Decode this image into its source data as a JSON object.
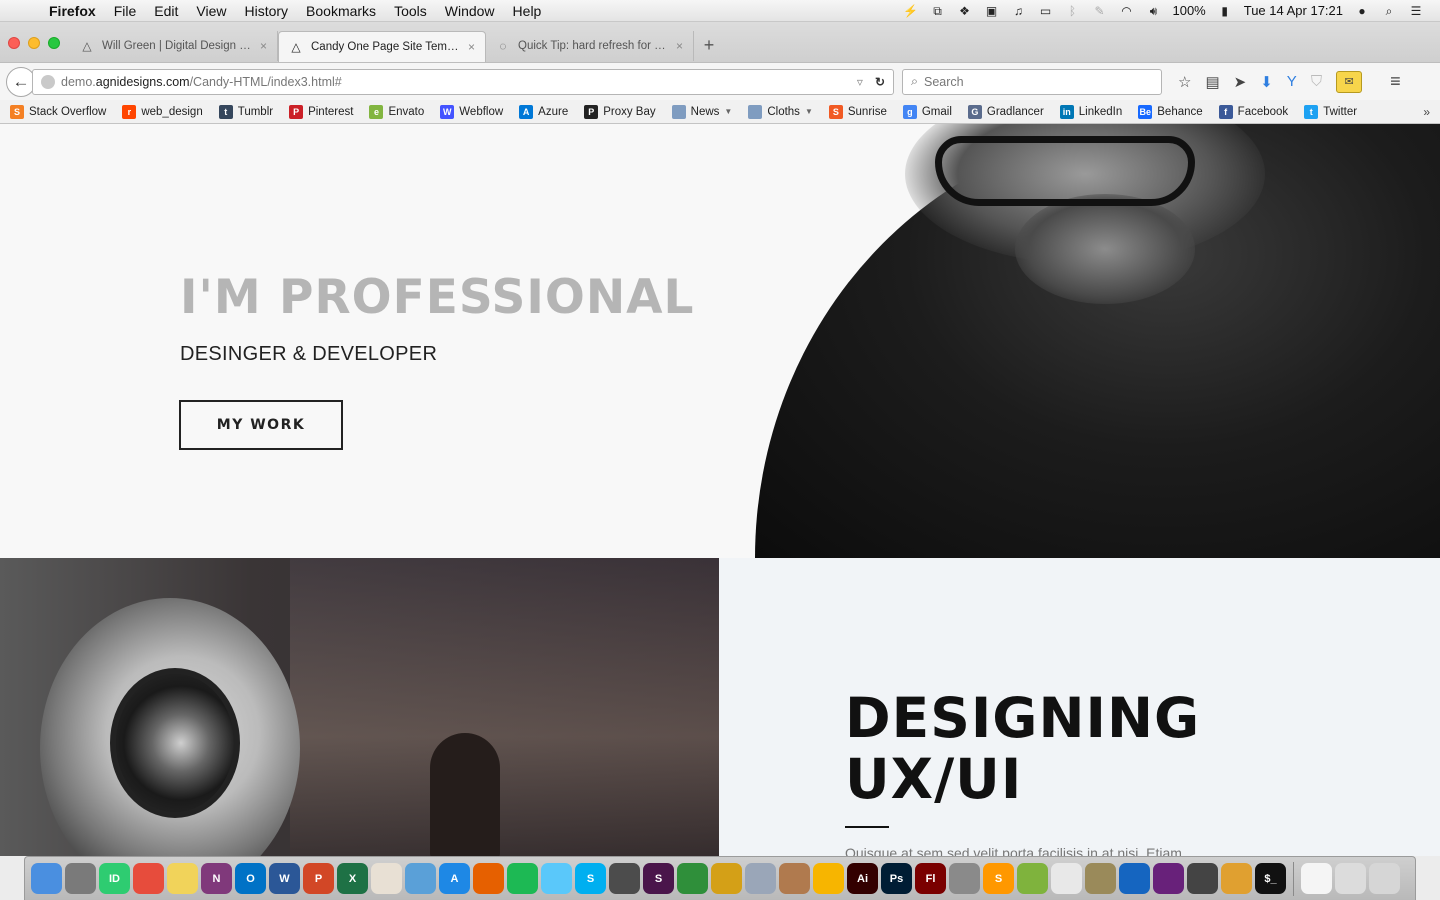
{
  "menubar": {
    "apple": "",
    "app_name": "Firefox",
    "menus": [
      "File",
      "Edit",
      "View",
      "History",
      "Bookmarks",
      "Tools",
      "Window",
      "Help"
    ],
    "battery": "100%",
    "datetime": "Tue 14 Apr  17:21"
  },
  "tabs": [
    {
      "title": "Will Green | Digital Design a...",
      "icon": "triangle-icon",
      "active": false
    },
    {
      "title": "Candy One Page Site Temp...",
      "icon": "triangle-icon",
      "active": true
    },
    {
      "title": "Quick Tip: hard refresh for F...",
      "icon": "loading-icon",
      "active": false
    }
  ],
  "navbar": {
    "url_prefix": "demo.",
    "url_host": "agnidesigns.com",
    "url_path": "/Candy-HTML/index3.html#",
    "search_placeholder": "Search"
  },
  "bookmarks": [
    {
      "label": "Stack Overflow",
      "color": "#f48024",
      "glyph": "S"
    },
    {
      "label": "web_design",
      "color": "#ff4500",
      "glyph": "r"
    },
    {
      "label": "Tumblr",
      "color": "#35465c",
      "glyph": "t"
    },
    {
      "label": "Pinterest",
      "color": "#cb2027",
      "glyph": "P"
    },
    {
      "label": "Envato",
      "color": "#82b540",
      "glyph": "e"
    },
    {
      "label": "Webflow",
      "color": "#4353ff",
      "glyph": "W"
    },
    {
      "label": "Azure",
      "color": "#0078d7",
      "glyph": "A"
    },
    {
      "label": "Proxy Bay",
      "color": "#222222",
      "glyph": "P"
    },
    {
      "label": "News",
      "color": "#7f9cc0",
      "glyph": "",
      "folder": true
    },
    {
      "label": "Cloths",
      "color": "#7f9cc0",
      "glyph": "",
      "folder": true
    },
    {
      "label": "Sunrise",
      "color": "#f15a24",
      "glyph": "S"
    },
    {
      "label": "Gmail",
      "color": "#4285f4",
      "glyph": "g"
    },
    {
      "label": "Gradlancer",
      "color": "#5a6b8c",
      "glyph": "G"
    },
    {
      "label": "LinkedIn",
      "color": "#0077b5",
      "glyph": "in"
    },
    {
      "label": "Behance",
      "color": "#1769ff",
      "glyph": "Be"
    },
    {
      "label": "Facebook",
      "color": "#3b5998",
      "glyph": "f"
    },
    {
      "label": "Twitter",
      "color": "#1da1f2",
      "glyph": "t"
    }
  ],
  "hero": {
    "title": "I'M PROFESSIONAL",
    "subtitle": "DESINGER & DEVELOPER",
    "button": "MY WORK"
  },
  "section2": {
    "title": "DESIGNING\nUX/UI",
    "text": "Quisque at sem sed velit porta facilisis in at nisi. Etiam"
  },
  "dock": [
    {
      "name": "finder-icon",
      "color": "#4a8fe0",
      "glyph": ""
    },
    {
      "name": "system-preferences-icon",
      "color": "#7a7a7a",
      "glyph": ""
    },
    {
      "name": "intellij-icon",
      "color": "#2ecc71",
      "glyph": "ID"
    },
    {
      "name": "opera-icon",
      "color": "#e74c3c",
      "glyph": ""
    },
    {
      "name": "stickies-icon",
      "color": "#f1d35a",
      "glyph": ""
    },
    {
      "name": "onenote-icon",
      "color": "#80397b",
      "glyph": "N"
    },
    {
      "name": "outlook-icon",
      "color": "#0072c6",
      "glyph": "O"
    },
    {
      "name": "word-icon",
      "color": "#2b5797",
      "glyph": "W"
    },
    {
      "name": "powerpoint-icon",
      "color": "#d24726",
      "glyph": "P"
    },
    {
      "name": "excel-icon",
      "color": "#1e7145",
      "glyph": "X"
    },
    {
      "name": "popcorn-icon",
      "color": "#e8e0d4",
      "glyph": ""
    },
    {
      "name": "drop-icon",
      "color": "#5aa0d8",
      "glyph": ""
    },
    {
      "name": "app-store-icon",
      "color": "#1e88e5",
      "glyph": "A"
    },
    {
      "name": "firefox-icon",
      "color": "#e66000",
      "glyph": ""
    },
    {
      "name": "spotify-icon",
      "color": "#1db954",
      "glyph": ""
    },
    {
      "name": "messages-icon",
      "color": "#5ac8fa",
      "glyph": ""
    },
    {
      "name": "skype-icon",
      "color": "#00aff0",
      "glyph": "S"
    },
    {
      "name": "scrivener-icon",
      "color": "#4c4c4c",
      "glyph": ""
    },
    {
      "name": "slack-icon",
      "color": "#4a154b",
      "glyph": "S"
    },
    {
      "name": "codekit-icon",
      "color": "#2f8f3a",
      "glyph": ""
    },
    {
      "name": "chrome-canary-icon",
      "color": "#d4a017",
      "glyph": ""
    },
    {
      "name": "preview-icon",
      "color": "#9aa6b8",
      "glyph": ""
    },
    {
      "name": "photos-icon",
      "color": "#b07a4e",
      "glyph": ""
    },
    {
      "name": "sketch-icon",
      "color": "#f7b500",
      "glyph": ""
    },
    {
      "name": "illustrator-icon",
      "color": "#330000",
      "glyph": "Ai"
    },
    {
      "name": "photoshop-icon",
      "color": "#001d34",
      "glyph": "Ps"
    },
    {
      "name": "flash-icon",
      "color": "#7a0000",
      "glyph": "Fl"
    },
    {
      "name": "scanner-icon",
      "color": "#8a8a8a",
      "glyph": ""
    },
    {
      "name": "sublime-icon",
      "color": "#ff9800",
      "glyph": "S"
    },
    {
      "name": "coda-icon",
      "color": "#7fb33d",
      "glyph": ""
    },
    {
      "name": "prism-icon",
      "color": "#e8e8e8",
      "glyph": ""
    },
    {
      "name": "robot-icon",
      "color": "#9a8a5a",
      "glyph": ""
    },
    {
      "name": "remote-desktop-icon",
      "color": "#1565c0",
      "glyph": ""
    },
    {
      "name": "visual-studio-icon",
      "color": "#68217a",
      "glyph": ""
    },
    {
      "name": "sequel-pro-icon",
      "color": "#444444",
      "glyph": ""
    },
    {
      "name": "database-icon",
      "color": "#e0a030",
      "glyph": ""
    },
    {
      "name": "terminal-icon",
      "color": "#111111",
      "glyph": "$_"
    },
    {
      "name": "microsoft-doc-icon",
      "color": "#f5f5f5",
      "glyph": ""
    },
    {
      "name": "downloads-icon",
      "color": "#dcdcdc",
      "glyph": ""
    },
    {
      "name": "trash-icon",
      "color": "#d6d6d6",
      "glyph": ""
    }
  ]
}
